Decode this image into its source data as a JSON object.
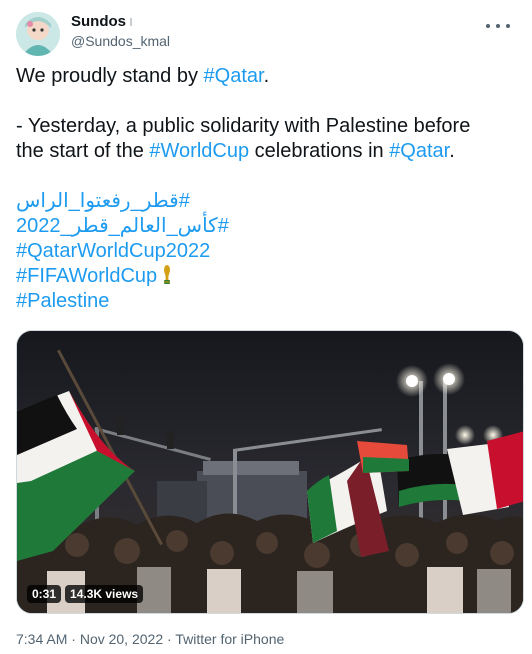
{
  "tweet": {
    "display_name": "Sundos",
    "handle": "@Sundos_kmal",
    "line1_text": "We proudly stand by ",
    "line1_tag": "#Qatar",
    "line1_end": ".",
    "line2_text": "- Yesterday, a public solidarity with Palestine before",
    "line3_text": "the start of the ",
    "line3_tag1": "#WorldCup",
    "line3_mid": " celebrations in ",
    "line3_tag2": "#Qatar",
    "line3_end": ".",
    "hashtags": [
      "#قطر_رفعتوا_الراس",
      "#كأس_العالم_قطر_2022",
      "#QatarWorldCup2022",
      "#FIFAWorldCup",
      "#Palestine"
    ],
    "trophy_icon": "trophy-icon"
  },
  "media": {
    "duration": "0:31",
    "views": "14.3K views"
  },
  "meta": {
    "time": "7:34 AM",
    "date": "Nov 20, 2022",
    "source": "Twitter for iPhone",
    "separator": " · "
  },
  "colors": {
    "link": "#1d9bf0",
    "text": "#0f1419",
    "secondary": "#536471"
  }
}
